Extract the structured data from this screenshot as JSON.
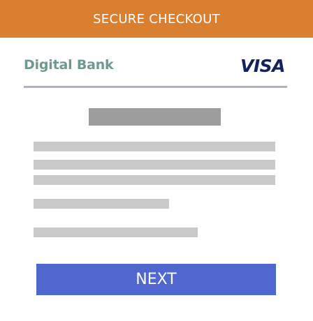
{
  "header": {
    "title": "SECURE CHECKOUT",
    "color": "#d97f2f"
  },
  "brand": {
    "bank_name": "Digital Bank",
    "card_network": "VISA"
  },
  "actions": {
    "next_label": "NEXT",
    "button_color": "#5067d0"
  }
}
